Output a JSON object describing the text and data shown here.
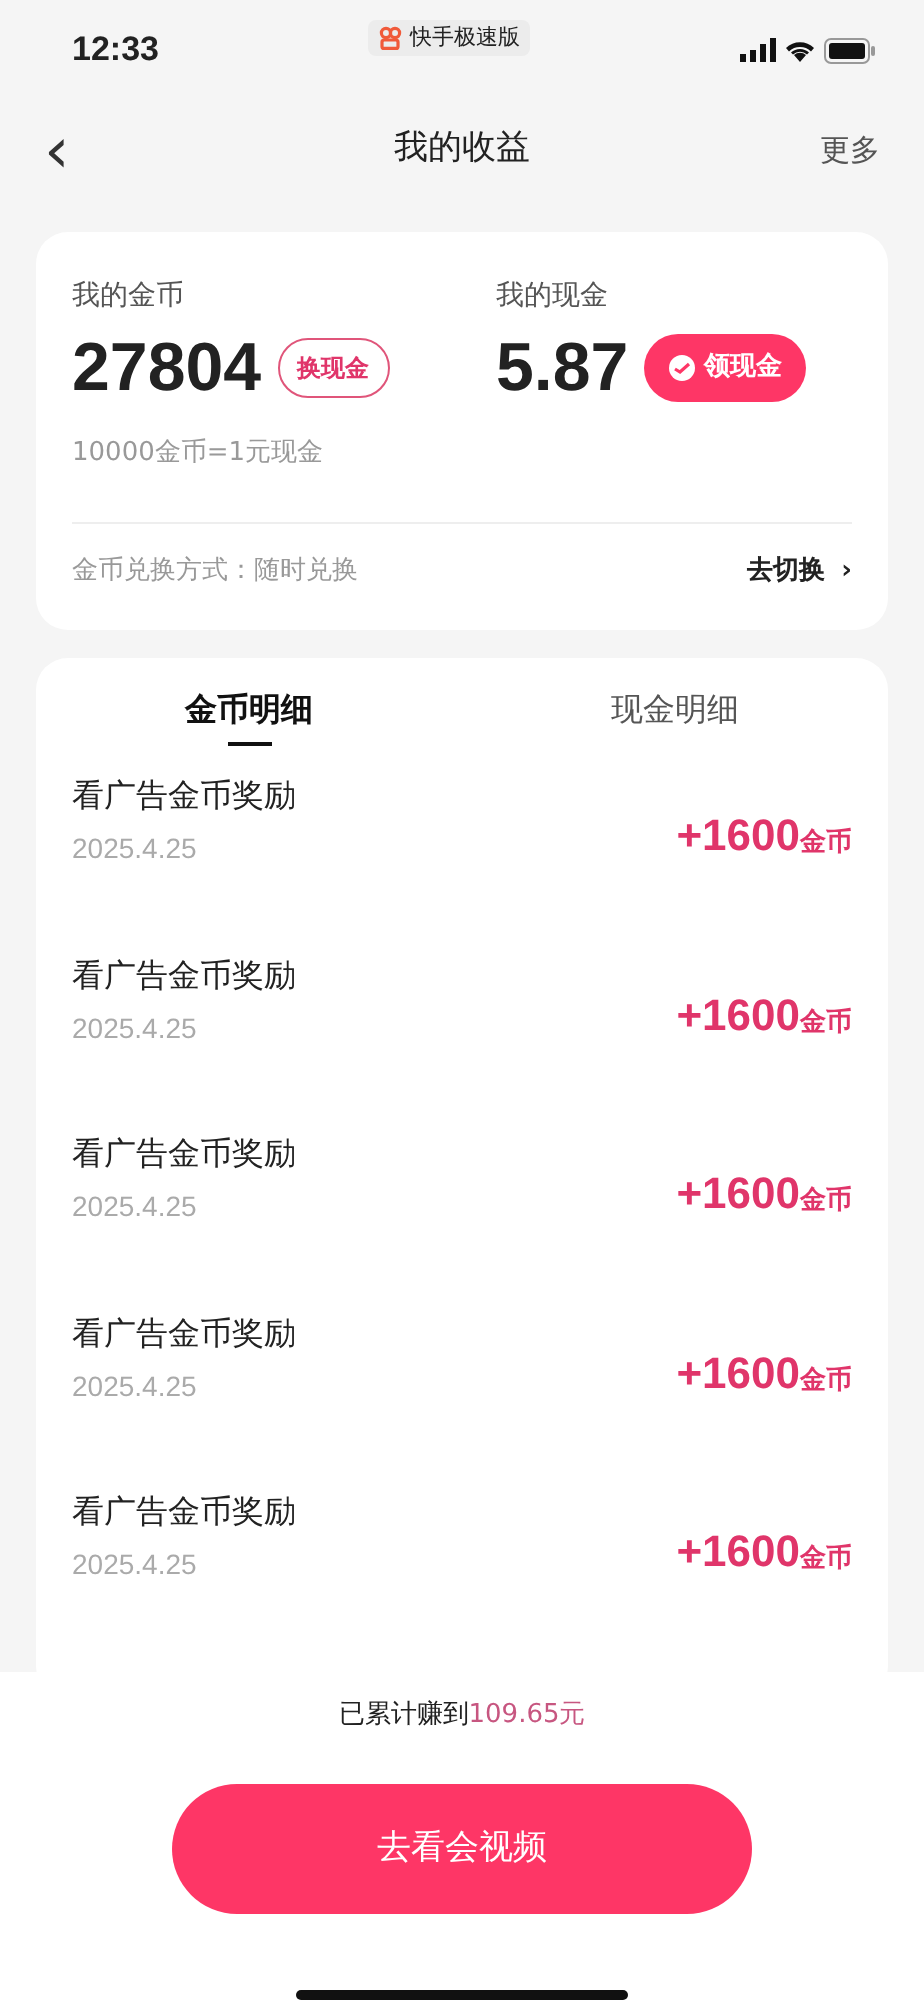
{
  "status_bar": {
    "time": "12:33",
    "app_badge": "快手极速版"
  },
  "header": {
    "back": "‹",
    "title": "我的收益",
    "more": "更多"
  },
  "balance": {
    "coins_label": "我的金币",
    "coins": "27804",
    "exchange_button": "换现金",
    "cash_label": "我的现金",
    "cash": "5.87",
    "withdraw_button": "领现金",
    "rate": "10000金币=1元现金",
    "method": "金币兑换方式：随时兑换",
    "switch_link": "去切换",
    "switch_arrow": "›"
  },
  "tabs": [
    {
      "label": "金币明细",
      "selected": true
    },
    {
      "label": "现金明细",
      "selected": false
    }
  ],
  "records": [
    {
      "title": "看广告金币奖励",
      "date": "2025.4.25",
      "amount": "+1600",
      "unit": "金币"
    },
    {
      "title": "看广告金币奖励",
      "date": "2025.4.25",
      "amount": "+1600",
      "unit": "金币"
    },
    {
      "title": "看广告金币奖励",
      "date": "2025.4.25",
      "amount": "+1600",
      "unit": "金币"
    },
    {
      "title": "看广告金币奖励",
      "date": "2025.4.25",
      "amount": "+1600",
      "unit": "金币"
    },
    {
      "title": "看广告金币奖励",
      "date": "2025.4.25",
      "amount": "+1600",
      "unit": "金币"
    }
  ],
  "footer": {
    "summary": "已累计赚到",
    "summary_amount": "109.65元",
    "button": "去看会视频"
  }
}
